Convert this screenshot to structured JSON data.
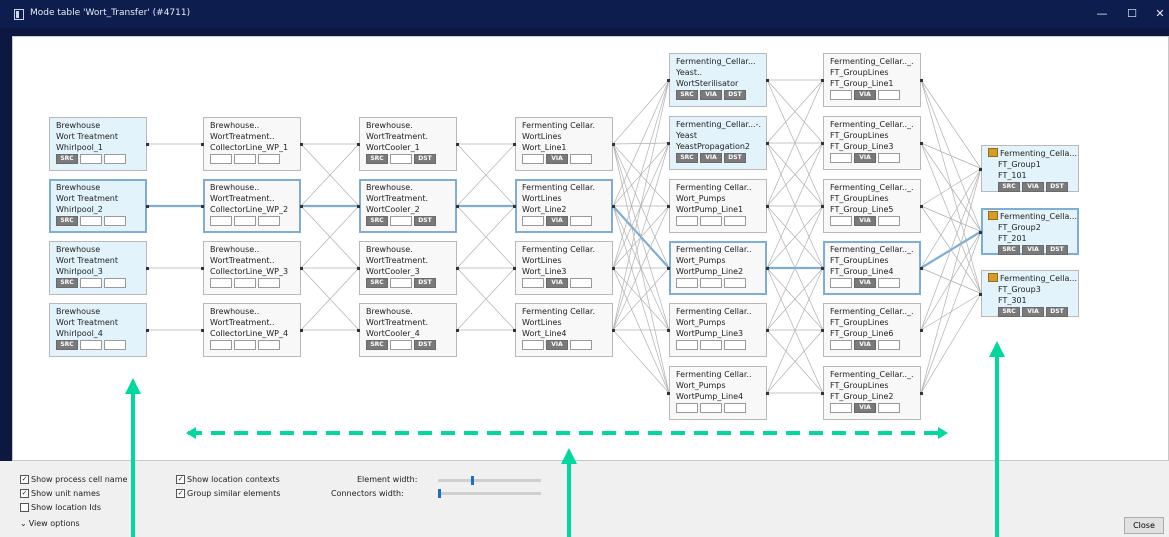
{
  "window": {
    "title": "Mode table 'Wort_Transfer' (#4711)",
    "minimize": "—",
    "maximize": "☐",
    "close": "✕"
  },
  "nodes": [
    {
      "col": 0,
      "row": 1,
      "lines": [
        "Brewhouse",
        "Wort Treatment",
        "Whirlpool_1"
      ],
      "tags": [
        "SRC",
        "",
        ""
      ],
      "blue": true,
      "hl": false
    },
    {
      "col": 0,
      "row": 2,
      "lines": [
        "Brewhouse",
        "Wort Treatment",
        "Whirlpool_2"
      ],
      "tags": [
        "SRC",
        "",
        ""
      ],
      "blue": true,
      "hl": true
    },
    {
      "col": 0,
      "row": 3,
      "lines": [
        "Brewhouse",
        "Wort Treatment",
        "Whirlpool_3"
      ],
      "tags": [
        "SRC",
        "",
        ""
      ],
      "blue": true,
      "hl": false
    },
    {
      "col": 0,
      "row": 4,
      "lines": [
        "Brewhouse",
        "Wort Treatment",
        "Whirlpool_4"
      ],
      "tags": [
        "SRC",
        "",
        ""
      ],
      "blue": true,
      "hl": false
    },
    {
      "col": 1,
      "row": 1,
      "lines": [
        "Brewhouse..",
        "WortTreatment..",
        "CollectorLine_WP_1"
      ],
      "tags": [
        "",
        "",
        ""
      ],
      "blue": false,
      "hl": false
    },
    {
      "col": 1,
      "row": 2,
      "lines": [
        "Brewhouse..",
        "WortTreatment..",
        "CollectorLine_WP_2"
      ],
      "tags": [
        "",
        "",
        ""
      ],
      "blue": false,
      "hl": true
    },
    {
      "col": 1,
      "row": 3,
      "lines": [
        "Brewhouse..",
        "WortTreatment..",
        "CollectorLine_WP_3"
      ],
      "tags": [
        "",
        "",
        ""
      ],
      "blue": false,
      "hl": false
    },
    {
      "col": 1,
      "row": 4,
      "lines": [
        "Brewhouse..",
        "WortTreatment..",
        "CollectorLine_WP_4"
      ],
      "tags": [
        "",
        "",
        ""
      ],
      "blue": false,
      "hl": false
    },
    {
      "col": 2,
      "row": 1,
      "lines": [
        "Brewhouse.",
        "WortTreatment.",
        "WortCooler_1"
      ],
      "tags": [
        "SRC",
        "",
        "DST"
      ],
      "blue": false,
      "hl": false
    },
    {
      "col": 2,
      "row": 2,
      "lines": [
        "Brewhouse.",
        "WortTreatment.",
        "WortCooler_2"
      ],
      "tags": [
        "SRC",
        "",
        "DST"
      ],
      "blue": false,
      "hl": true
    },
    {
      "col": 2,
      "row": 3,
      "lines": [
        "Brewhouse.",
        "WortTreatment.",
        "WortCooler_3"
      ],
      "tags": [
        "SRC",
        "",
        "DST"
      ],
      "blue": false,
      "hl": false
    },
    {
      "col": 2,
      "row": 4,
      "lines": [
        "Brewhouse.",
        "WortTreatment.",
        "WortCooler_4"
      ],
      "tags": [
        "SRC",
        "",
        "DST"
      ],
      "blue": false,
      "hl": false
    },
    {
      "col": 3,
      "row": 1,
      "lines": [
        "Fermenting Cellar.",
        "WortLines",
        "Wort_Line1"
      ],
      "tags": [
        "",
        "VIA",
        ""
      ],
      "blue": false,
      "hl": false
    },
    {
      "col": 3,
      "row": 2,
      "lines": [
        "Fermenting Cellar.",
        "WortLines",
        "Wort_Line2"
      ],
      "tags": [
        "",
        "VIA",
        ""
      ],
      "blue": false,
      "hl": true
    },
    {
      "col": 3,
      "row": 3,
      "lines": [
        "Fermenting Cellar.",
        "WortLines",
        "Wort_Line3"
      ],
      "tags": [
        "",
        "VIA",
        ""
      ],
      "blue": false,
      "hl": false
    },
    {
      "col": 3,
      "row": 4,
      "lines": [
        "Fermenting Cellar.",
        "WortLines",
        "Wort_Line4"
      ],
      "tags": [
        "",
        "VIA",
        ""
      ],
      "blue": false,
      "hl": false
    },
    {
      "col": 4,
      "row": 0,
      "lines": [
        "Fermenting_Cellar...",
        "Yeast..",
        "WortSterilisator"
      ],
      "tags": [
        "SRC",
        "VIA",
        "DST"
      ],
      "blue": true,
      "hl": false
    },
    {
      "col": 4,
      "row": 1,
      "lines": [
        "Fermenting_Cellar...-.",
        "Yeast",
        "YeastPropagation2"
      ],
      "tags": [
        "SRC",
        "VIA",
        "DST"
      ],
      "blue": true,
      "hl": false
    },
    {
      "col": 4,
      "row": 2,
      "lines": [
        "Fermenting Cellar..",
        "Wort_Pumps",
        "WortPump_Line1"
      ],
      "tags": [
        "",
        "",
        ""
      ],
      "blue": false,
      "hl": false
    },
    {
      "col": 4,
      "row": 3,
      "lines": [
        "Fermenting Cellar..",
        "Wort_Pumps",
        "WortPump_Line2"
      ],
      "tags": [
        "",
        "",
        ""
      ],
      "blue": false,
      "hl": true
    },
    {
      "col": 4,
      "row": 4,
      "lines": [
        "Fermenting Cellar..",
        "Wort_Pumps",
        "WortPump_Line3"
      ],
      "tags": [
        "",
        "",
        ""
      ],
      "blue": false,
      "hl": false
    },
    {
      "col": 4,
      "row": 5,
      "lines": [
        "Fermenting Cellar..",
        "Wort_Pumps",
        "WortPump_Line4"
      ],
      "tags": [
        "",
        "",
        ""
      ],
      "blue": false,
      "hl": false
    },
    {
      "col": 5,
      "row": 0,
      "lines": [
        "Fermenting_Cellar.._.",
        "FT_GroupLines",
        "FT_Group_Line1"
      ],
      "tags": [
        "",
        "VIA",
        ""
      ],
      "blue": false,
      "hl": false
    },
    {
      "col": 5,
      "row": 1,
      "lines": [
        "Fermenting_Cellar.._.",
        "FT_GroupLines",
        "FT_Group_Line3"
      ],
      "tags": [
        "",
        "VIA",
        ""
      ],
      "blue": false,
      "hl": false
    },
    {
      "col": 5,
      "row": 2,
      "lines": [
        "Fermenting_Cellar.._.",
        "FT_GroupLines",
        "FT_Group_Line5"
      ],
      "tags": [
        "",
        "VIA",
        ""
      ],
      "blue": false,
      "hl": false
    },
    {
      "col": 5,
      "row": 3,
      "lines": [
        "Fermenting_Cellar.._.",
        "FT_GroupLines",
        "FT_Group_Line4"
      ],
      "tags": [
        "",
        "VIA",
        ""
      ],
      "blue": false,
      "hl": true
    },
    {
      "col": 5,
      "row": 4,
      "lines": [
        "Fermenting_Cellar.._.",
        "FT_GroupLines",
        "FT_Group_Line6"
      ],
      "tags": [
        "",
        "VIA",
        ""
      ],
      "blue": false,
      "hl": false
    },
    {
      "col": 5,
      "row": 5,
      "lines": [
        "Fermenting_Cellar.._.",
        "FT_GroupLines",
        "FT_Group_Line2"
      ],
      "tags": [
        "",
        "VIA",
        ""
      ],
      "blue": false,
      "hl": false
    },
    {
      "col": 6,
      "row": 0,
      "lines": [
        "Fermenting_Cella...",
        "FT_Group1",
        "FT_101"
      ],
      "tags": [
        "SRC",
        "VIA",
        "DST"
      ],
      "blue": true,
      "hl": false,
      "ft": true
    },
    {
      "col": 6,
      "row": 1,
      "lines": [
        "Fermenting_Cella...",
        "FT_Group2",
        "FT_201"
      ],
      "tags": [
        "SRC",
        "VIA",
        "DST"
      ],
      "blue": true,
      "hl": true,
      "ft": true
    },
    {
      "col": 6,
      "row": 2,
      "lines": [
        "Fermenting_Cella...",
        "FT_Group3",
        "FT_301"
      ],
      "tags": [
        "SRC",
        "VIA",
        "DST"
      ],
      "blue": true,
      "hl": false,
      "ft": true
    }
  ],
  "options": {
    "show_process_cell_name": {
      "label": "Show process cell name",
      "checked": true
    },
    "show_unit_names": {
      "label": "Show unit names",
      "checked": true
    },
    "show_location_ids": {
      "label": "Show location Ids",
      "checked": false
    },
    "show_location_contexts": {
      "label": "Show location contexts",
      "checked": true
    },
    "group_similar_elements": {
      "label": "Group similar elements",
      "checked": true
    },
    "element_width": {
      "label": "Element width:",
      "value": 0.33
    },
    "connectors_width": {
      "label": "Connectors width:",
      "value": 0.0
    },
    "view_options": "View options"
  },
  "close_label": "Close",
  "colors": {
    "accent": "#7eaed6",
    "annotation": "#00d8a0",
    "selected_bg": "#e2f3fb"
  }
}
